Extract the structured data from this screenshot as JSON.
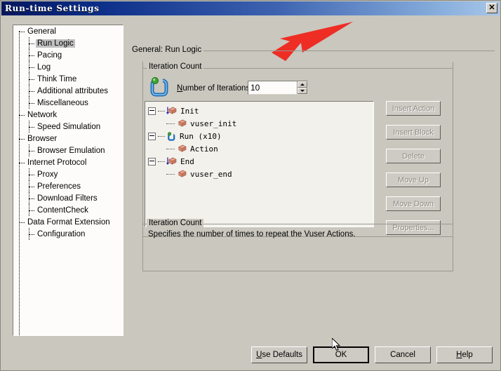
{
  "window": {
    "title": "Run-time Settings",
    "close_label": "✕",
    "bg_color": "#c9c7be",
    "titlebar_color_left": "#06175e",
    "titlebar_color_right": "#a8c6e8"
  },
  "sidebar": {
    "items": [
      {
        "label": "General",
        "level": 1,
        "selected": false
      },
      {
        "label": "Run Logic",
        "level": 2,
        "selected": true
      },
      {
        "label": "Pacing",
        "level": 2,
        "selected": false
      },
      {
        "label": "Log",
        "level": 2,
        "selected": false
      },
      {
        "label": "Think Time",
        "level": 2,
        "selected": false
      },
      {
        "label": "Additional attributes",
        "level": 2,
        "selected": false
      },
      {
        "label": "Miscellaneous",
        "level": 2,
        "selected": false
      },
      {
        "label": "Network",
        "level": 1,
        "selected": false
      },
      {
        "label": "Speed Simulation",
        "level": 2,
        "selected": false
      },
      {
        "label": "Browser",
        "level": 1,
        "selected": false
      },
      {
        "label": "Browser Emulation",
        "level": 2,
        "selected": false
      },
      {
        "label": "Internet Protocol",
        "level": 1,
        "selected": false
      },
      {
        "label": "Proxy",
        "level": 2,
        "selected": false
      },
      {
        "label": "Preferences",
        "level": 2,
        "selected": false
      },
      {
        "label": "Download Filters",
        "level": 2,
        "selected": false
      },
      {
        "label": "ContentCheck",
        "level": 2,
        "selected": false
      },
      {
        "label": "Data Format Extension",
        "level": 1,
        "selected": false
      },
      {
        "label": "Configuration",
        "level": 2,
        "selected": false
      }
    ]
  },
  "main": {
    "panel_header": "General: Run Logic",
    "iteration_group_title": "Iteration Count",
    "iterations_label": "Number of Iterations:",
    "iterations_value": "10",
    "action_tree": [
      {
        "label": "Init",
        "level": 1,
        "icon": "brick-arrow-icon",
        "expander": true
      },
      {
        "label": "vuser_init",
        "level": 2,
        "icon": "brick-icon",
        "expander": false
      },
      {
        "label": "Run  (x10)",
        "level": 1,
        "icon": "loop-icon",
        "expander": true
      },
      {
        "label": "Action",
        "level": 2,
        "icon": "brick-icon",
        "expander": false
      },
      {
        "label": "End",
        "level": 1,
        "icon": "brick-arrow-icon",
        "expander": true
      },
      {
        "label": "vuser_end",
        "level": 2,
        "icon": "brick-icon",
        "expander": false
      }
    ],
    "side_buttons": [
      {
        "label": "Insert Action",
        "disabled": true
      },
      {
        "label": "Insert Block",
        "disabled": true
      },
      {
        "label": "Delete",
        "disabled": true
      },
      {
        "label": "Move Up",
        "disabled": true
      },
      {
        "label": "Move Down",
        "disabled": true
      },
      {
        "label": "Properties...",
        "disabled": true
      }
    ],
    "description_group_title": "Iteration Count",
    "description_text": "Specifies the number of times to repeat the Vuser Actions."
  },
  "footer": {
    "use_defaults": "Use Defaults",
    "ok": "OK",
    "cancel": "Cancel",
    "help": "Help"
  },
  "annotation": {
    "arrow_color": "#ee2d24"
  }
}
